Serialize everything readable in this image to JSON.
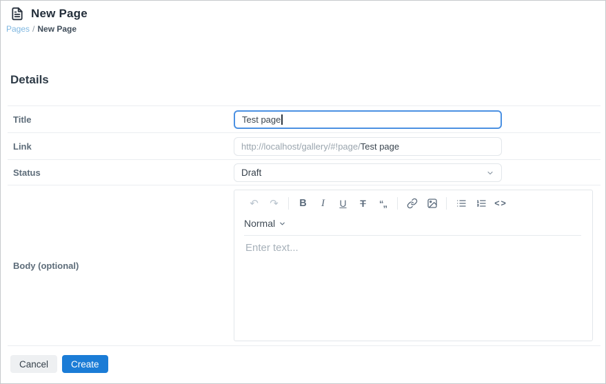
{
  "header": {
    "title": "New Page",
    "breadcrumb": {
      "parent": "Pages",
      "separator": "/",
      "current": "New Page"
    }
  },
  "section": {
    "heading": "Details"
  },
  "form": {
    "title": {
      "label": "Title",
      "value": "Test page",
      "placeholder": ""
    },
    "link": {
      "label": "Link",
      "url_prefix": "http://localhost/gallery/#!page/",
      "url_suffix": "Test page"
    },
    "status": {
      "label": "Status",
      "selected": "Draft"
    },
    "body": {
      "label": "Body (optional)",
      "paragraph_style": "Normal",
      "placeholder": "Enter text..."
    }
  },
  "editor_toolbar_glyphs": {
    "undo": "↶",
    "redo": "↷",
    "bold": "B",
    "italic": "I",
    "underline": "U",
    "strikethrough": "T",
    "blockquote": "“„",
    "code": "<>",
    "link_icon": "chain-shape",
    "image_icon": "picture-shape",
    "bullet_list_icon": "list-shape",
    "ordered_list_icon": "numbered-list-shape"
  },
  "actions": {
    "cancel": "Cancel",
    "create": "Create"
  },
  "colors": {
    "accent_blue": "#1b7cd6",
    "focus_border": "#4a90e2",
    "breadcrumb_link": "#7db6e0",
    "label_text": "#5d6c79",
    "divider": "#eaedf0"
  }
}
